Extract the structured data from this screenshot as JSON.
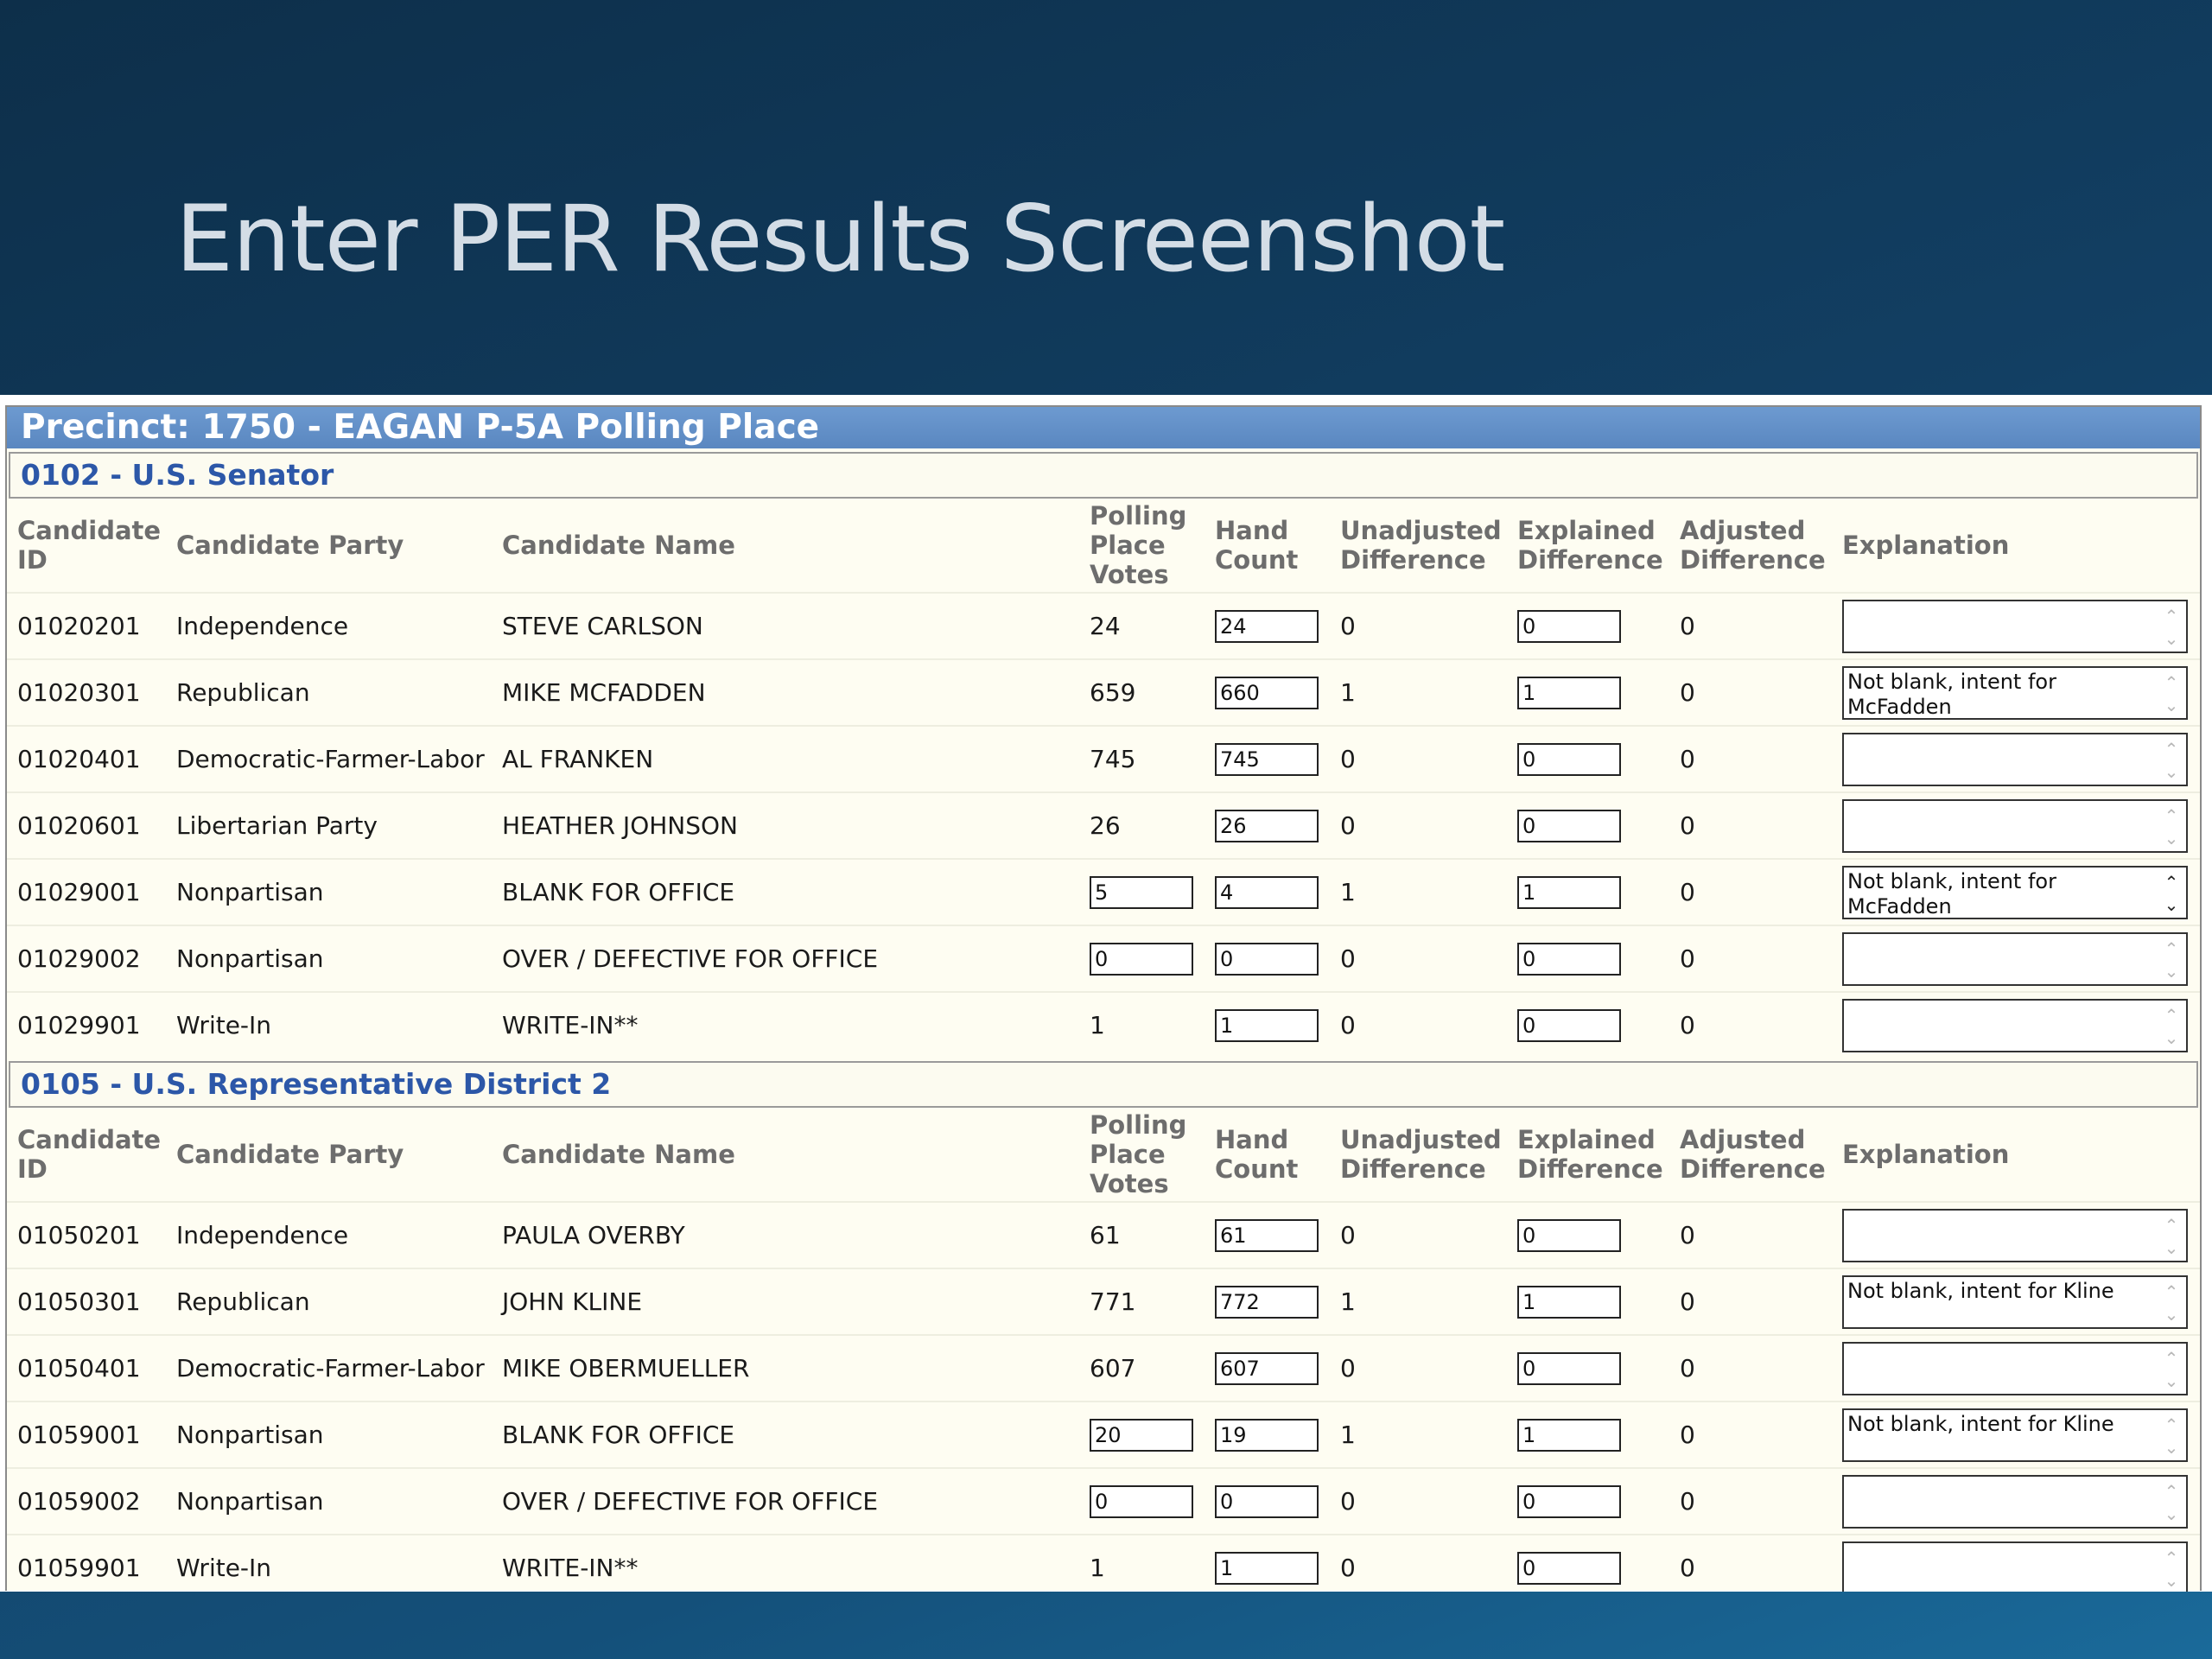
{
  "slide_title": "Enter PER Results Screenshot",
  "precinct_title": "Precinct: 1750 - EAGAN P-5A Polling Place",
  "columns": {
    "candidate_id": "Candidate ID",
    "candidate_party": "Candidate Party",
    "candidate_name": "Candidate Name",
    "polling_place_votes": "Polling Place Votes",
    "hand_count": "Hand Count",
    "unadjusted_difference": "Unadjusted Difference",
    "explained_difference": "Explained Difference",
    "adjusted_difference": "Adjusted Difference",
    "explanation": "Explanation"
  },
  "sections": [
    {
      "title": "0102 - U.S. Senator",
      "rows": [
        {
          "id": "01020201",
          "party": "Independence",
          "name": "STEVE CARLSON",
          "votes": "24",
          "votes_editable": false,
          "hand": "24",
          "unadj": "0",
          "explained": "0",
          "adj": "0",
          "explanation": ""
        },
        {
          "id": "01020301",
          "party": "Republican",
          "name": "MIKE MCFADDEN",
          "votes": "659",
          "votes_editable": false,
          "hand": "660",
          "unadj": "1",
          "explained": "1",
          "adj": "0",
          "explanation": "Not blank, intent for McFadden"
        },
        {
          "id": "01020401",
          "party": "Democratic-Farmer-Labor",
          "name": "AL FRANKEN",
          "votes": "745",
          "votes_editable": false,
          "hand": "745",
          "unadj": "0",
          "explained": "0",
          "adj": "0",
          "explanation": ""
        },
        {
          "id": "01020601",
          "party": "Libertarian Party",
          "name": "HEATHER JOHNSON",
          "votes": "26",
          "votes_editable": false,
          "hand": "26",
          "unadj": "0",
          "explained": "0",
          "adj": "0",
          "explanation": ""
        },
        {
          "id": "01029001",
          "party": "Nonpartisan",
          "name": "BLANK FOR OFFICE",
          "votes": "5",
          "votes_editable": true,
          "hand": "4",
          "unadj": "1",
          "explained": "1",
          "adj": "0",
          "explanation": "Not blank, intent for McFadden",
          "spin_dark": true
        },
        {
          "id": "01029002",
          "party": "Nonpartisan",
          "name": "OVER / DEFECTIVE FOR OFFICE",
          "votes": "0",
          "votes_editable": true,
          "hand": "0",
          "unadj": "0",
          "explained": "0",
          "adj": "0",
          "explanation": ""
        },
        {
          "id": "01029901",
          "party": "Write-In",
          "name": "WRITE-IN**",
          "votes": "1",
          "votes_editable": false,
          "hand": "1",
          "unadj": "0",
          "explained": "0",
          "adj": "0",
          "explanation": ""
        }
      ]
    },
    {
      "title": "0105 - U.S. Representative District 2",
      "rows": [
        {
          "id": "01050201",
          "party": "Independence",
          "name": "PAULA OVERBY",
          "votes": "61",
          "votes_editable": false,
          "hand": "61",
          "unadj": "0",
          "explained": "0",
          "adj": "0",
          "explanation": ""
        },
        {
          "id": "01050301",
          "party": "Republican",
          "name": "JOHN KLINE",
          "votes": "771",
          "votes_editable": false,
          "hand": "772",
          "unadj": "1",
          "explained": "1",
          "adj": "0",
          "explanation": "Not blank, intent for Kline"
        },
        {
          "id": "01050401",
          "party": "Democratic-Farmer-Labor",
          "name": "MIKE OBERMUELLER",
          "votes": "607",
          "votes_editable": false,
          "hand": "607",
          "unadj": "0",
          "explained": "0",
          "adj": "0",
          "explanation": ""
        },
        {
          "id": "01059001",
          "party": "Nonpartisan",
          "name": "BLANK FOR OFFICE",
          "votes": "20",
          "votes_editable": true,
          "hand": "19",
          "unadj": "1",
          "explained": "1",
          "adj": "0",
          "explanation": "Not blank, intent for Kline"
        },
        {
          "id": "01059002",
          "party": "Nonpartisan",
          "name": "OVER / DEFECTIVE FOR OFFICE",
          "votes": "0",
          "votes_editable": true,
          "hand": "0",
          "unadj": "0",
          "explained": "0",
          "adj": "0",
          "explanation": ""
        },
        {
          "id": "01059901",
          "party": "Write-In",
          "name": "WRITE-IN**",
          "votes": "1",
          "votes_editable": false,
          "hand": "1",
          "unadj": "0",
          "explained": "0",
          "adj": "0",
          "explanation": ""
        }
      ]
    }
  ]
}
